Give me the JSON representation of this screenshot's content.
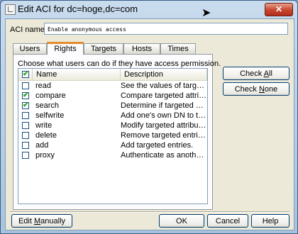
{
  "window": {
    "title": "Edit ACI for dc=hoge,dc=com",
    "close_glyph": "✕"
  },
  "aci": {
    "label": "ACI name:",
    "value": "Enable anonymous access"
  },
  "tabs": [
    {
      "label": "Users"
    },
    {
      "label": "Rights"
    },
    {
      "label": "Targets"
    },
    {
      "label": "Hosts"
    },
    {
      "label": "Times"
    }
  ],
  "active_tab": "Rights",
  "panel": {
    "description": "Choose what users can do if they have access permission.",
    "columns": {
      "check": "✔",
      "name": "Name",
      "description": "Description"
    },
    "rights": [
      {
        "name": "read",
        "description": "See the values of targeted attri...",
        "checked": false
      },
      {
        "name": "compare",
        "description": "Compare targeted attribute valu...",
        "checked": true
      },
      {
        "name": "search",
        "description": "Determine if targeted attributes ...",
        "checked": true
      },
      {
        "name": "selfwrite",
        "description": "Add one's own DN to the target.",
        "checked": false
      },
      {
        "name": "write",
        "description": "Modify targeted attributes.",
        "checked": false
      },
      {
        "name": "delete",
        "description": "Remove targeted entries.",
        "checked": false
      },
      {
        "name": "add",
        "description": "Add targeted entries.",
        "checked": false
      },
      {
        "name": "proxy",
        "description": "Authenticate as another user.",
        "checked": false
      }
    ]
  },
  "buttons": {
    "check_all": {
      "before": "Check ",
      "mnemonic": "A",
      "after": "ll"
    },
    "check_none": {
      "before": "Check ",
      "mnemonic": "N",
      "after": "one"
    },
    "edit_manually": {
      "before": "Edit ",
      "mnemonic": "M",
      "after": "anually"
    },
    "ok": "OK",
    "cancel": "Cancel",
    "help": "Help"
  },
  "colors": {
    "tab_highlight": "#e68b2c",
    "check_mark": "#21a121",
    "title_bar": "#a9c3de",
    "close_button": "#c7442c"
  },
  "icons": {
    "title": "window-icon",
    "cursor": "mouse-pointer-icon",
    "close": "close-icon"
  }
}
